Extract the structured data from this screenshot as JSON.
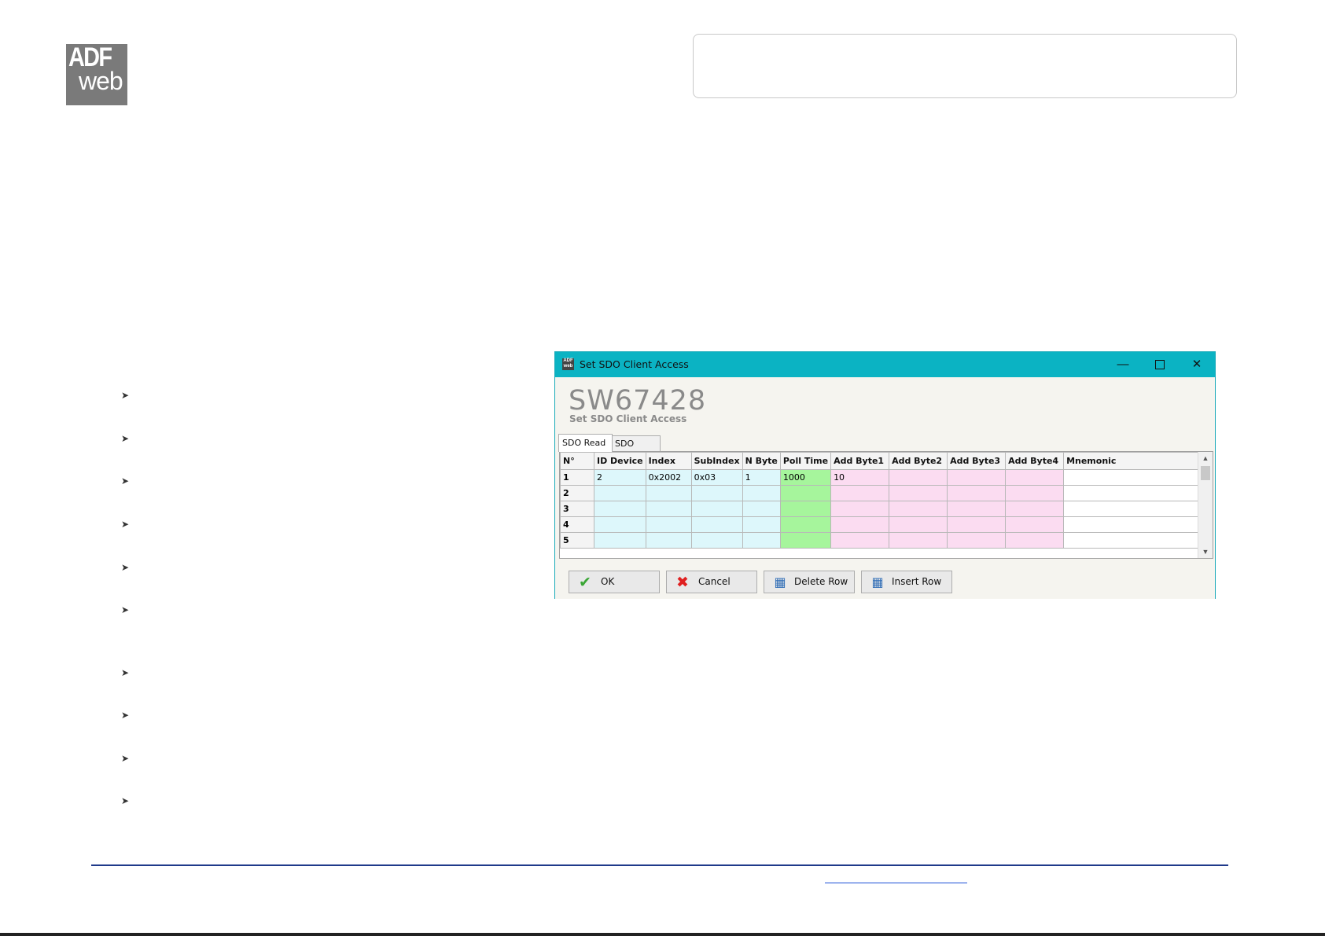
{
  "logo": {
    "line1": "ADF",
    "line2": "web"
  },
  "dialog": {
    "window_title": "Set SDO Client Access",
    "product": "SW67428",
    "subtitle": "Set SDO Client Access",
    "tabs": [
      {
        "label": "SDO Read",
        "active": true
      },
      {
        "label": "SDO Write",
        "active": false
      }
    ],
    "columns": [
      "N°",
      "ID Device",
      "Index",
      "SubIndex",
      "N Byte",
      "Poll Time",
      "Add Byte1",
      "Add Byte2",
      "Add Byte3",
      "Add Byte4",
      "Mnemonic"
    ],
    "rows": [
      {
        "n": "1",
        "id_device": "2",
        "index": "0x2002",
        "subindex": "0x03",
        "n_byte": "1",
        "poll_time": "1000",
        "add1": "10",
        "add2": "",
        "add3": "",
        "add4": "",
        "mnemonic": ""
      },
      {
        "n": "2",
        "id_device": "",
        "index": "",
        "subindex": "",
        "n_byte": "",
        "poll_time": "",
        "add1": "",
        "add2": "",
        "add3": "",
        "add4": "",
        "mnemonic": ""
      },
      {
        "n": "3",
        "id_device": "",
        "index": "",
        "subindex": "",
        "n_byte": "",
        "poll_time": "",
        "add1": "",
        "add2": "",
        "add3": "",
        "add4": "",
        "mnemonic": ""
      },
      {
        "n": "4",
        "id_device": "",
        "index": "",
        "subindex": "",
        "n_byte": "",
        "poll_time": "",
        "add1": "",
        "add2": "",
        "add3": "",
        "add4": "",
        "mnemonic": ""
      },
      {
        "n": "5",
        "id_device": "",
        "index": "",
        "subindex": "",
        "n_byte": "",
        "poll_time": "",
        "add1": "",
        "add2": "",
        "add3": "",
        "add4": "",
        "mnemonic": ""
      }
    ],
    "buttons": {
      "ok": "OK",
      "cancel": "Cancel",
      "delete_row": "Delete Row",
      "insert_row": "Insert Row"
    },
    "colors": {
      "titlebar": "#0bb3c3",
      "cyan_cells": "#ddf7fb",
      "green_cells": "#a6f59c",
      "pink_cells": "#fbdcf1"
    }
  },
  "icons": [
    "bullet-arrow-icon",
    "app-icon",
    "minimize-icon",
    "maximize-icon",
    "close-icon",
    "checkmark-icon",
    "x-icon",
    "delete-row-icon",
    "insert-row-icon",
    "scroll-up-icon",
    "scroll-down-icon"
  ]
}
